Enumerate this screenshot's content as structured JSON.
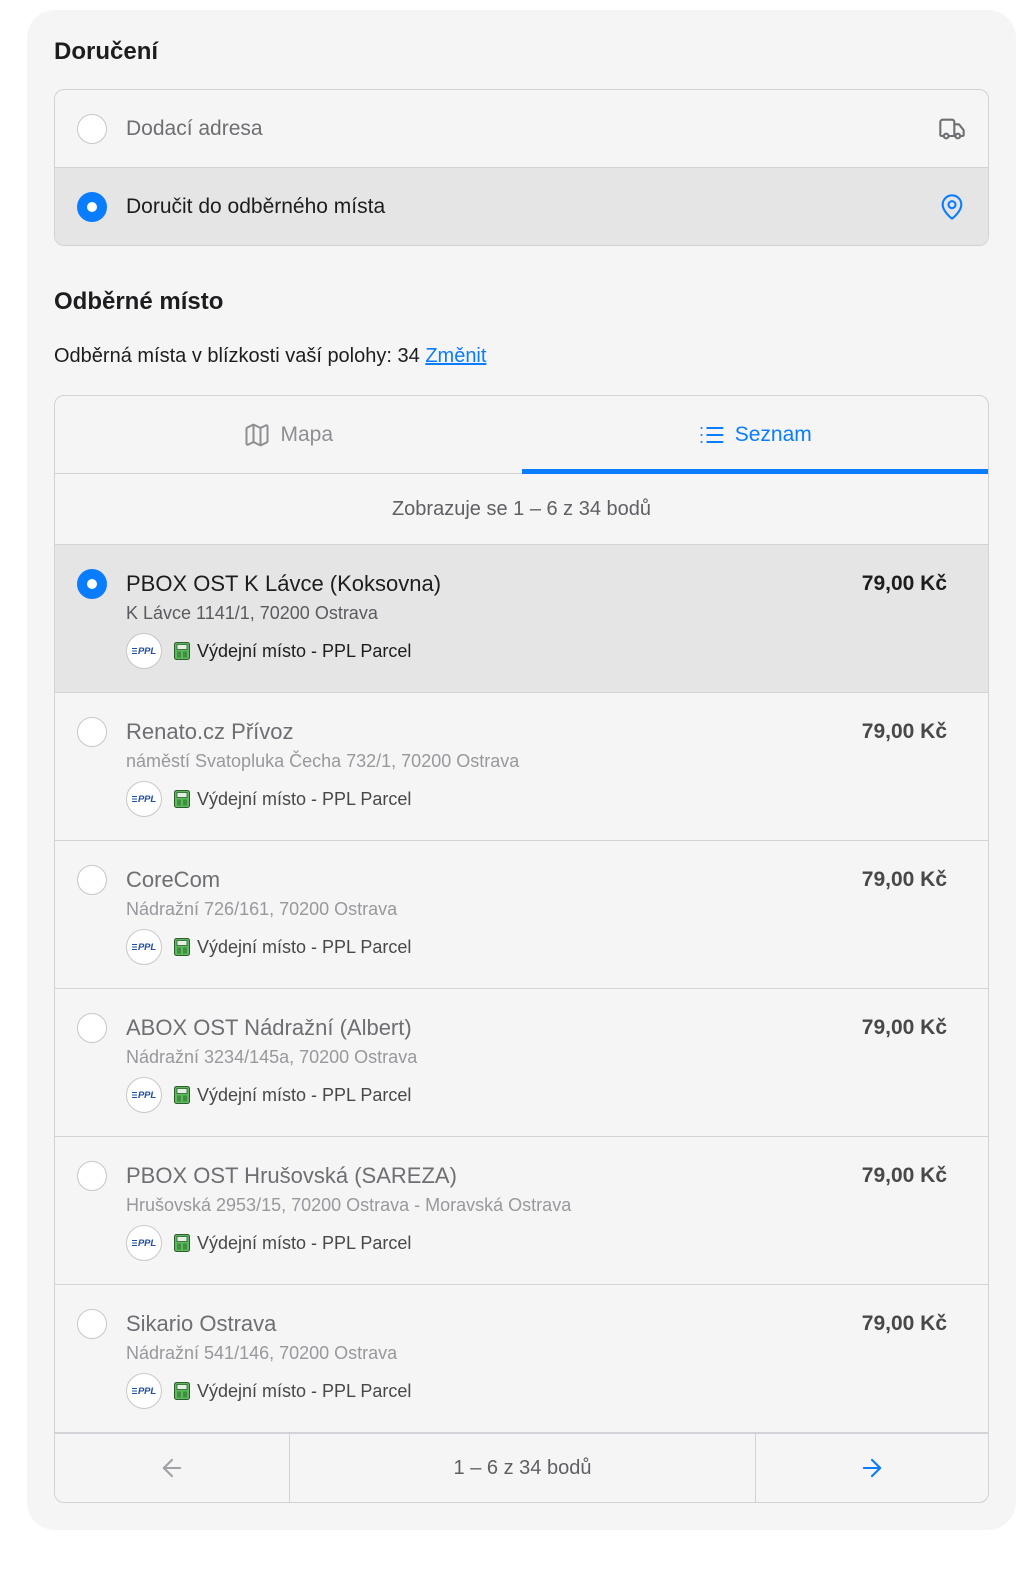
{
  "delivery": {
    "title": "Doručení",
    "options": [
      {
        "label": "Dodací adresa",
        "icon": "truck-icon",
        "selected": false
      },
      {
        "label": "Doručit do odběrného místa",
        "icon": "map-pin-icon",
        "selected": true
      }
    ]
  },
  "pickup": {
    "title": "Odběrné místo",
    "nearby_label": "Odběrná místa v blízkosti vaší polohy:",
    "nearby_count": "34",
    "change_link": "Změnit",
    "tabs": [
      {
        "label": "Mapa",
        "icon": "map-icon",
        "active": false
      },
      {
        "label": "Seznam",
        "icon": "list-icon",
        "active": true
      }
    ],
    "summary": "Zobrazuje se 1 – 6 z 34 bodů",
    "points": [
      {
        "name": "PBOX OST K Lávce (Koksovna)",
        "address": "K Lávce 1141/1, 70200 Ostrava",
        "price": "79,00 Kč",
        "carrier_logo": "PPL",
        "type_icon": "parcel-locker-icon",
        "type": "Výdejní místo - PPL Parcel",
        "selected": true
      },
      {
        "name": "Renato.cz Přívoz",
        "address": "náměstí Svatopluka Čecha 732/1, 70200 Ostrava",
        "price": "79,00 Kč",
        "carrier_logo": "PPL",
        "type_icon": "parcel-locker-icon",
        "type": "Výdejní místo - PPL Parcel",
        "selected": false
      },
      {
        "name": "CoreCom",
        "address": "Nádražní 726/161, 70200 Ostrava",
        "price": "79,00 Kč",
        "carrier_logo": "PPL",
        "type_icon": "parcel-locker-icon",
        "type": "Výdejní místo - PPL Parcel",
        "selected": false
      },
      {
        "name": "ABOX OST Nádražní (Albert)",
        "address": "Nádražní 3234/145a, 70200 Ostrava",
        "price": "79,00 Kč",
        "carrier_logo": "PPL",
        "type_icon": "parcel-locker-icon",
        "type": "Výdejní místo - PPL Parcel",
        "selected": false
      },
      {
        "name": "PBOX OST Hrušovská (SAREZA)",
        "address": "Hrušovská 2953/15, 70200 Ostrava - Moravská Ostrava",
        "price": "79,00 Kč",
        "carrier_logo": "PPL",
        "type_icon": "parcel-locker-icon",
        "type": "Výdejní místo - PPL Parcel",
        "selected": false
      },
      {
        "name": "Sikario Ostrava",
        "address": "Nádražní 541/146, 70200 Ostrava",
        "price": "79,00 Kč",
        "carrier_logo": "PPL",
        "type_icon": "parcel-locker-icon",
        "type": "Výdejní místo - PPL Parcel",
        "selected": false
      }
    ],
    "pagination": {
      "label": "1 – 6 z 34 bodů",
      "prev_icon": "arrow-left-icon",
      "next_icon": "arrow-right-icon",
      "prev_enabled": false,
      "next_enabled": true
    }
  },
  "colors": {
    "accent": "#0a7cff",
    "panel_background": "#f5f5f5",
    "selected_background": "#e5e5e5",
    "border": "#d2d2d7"
  }
}
